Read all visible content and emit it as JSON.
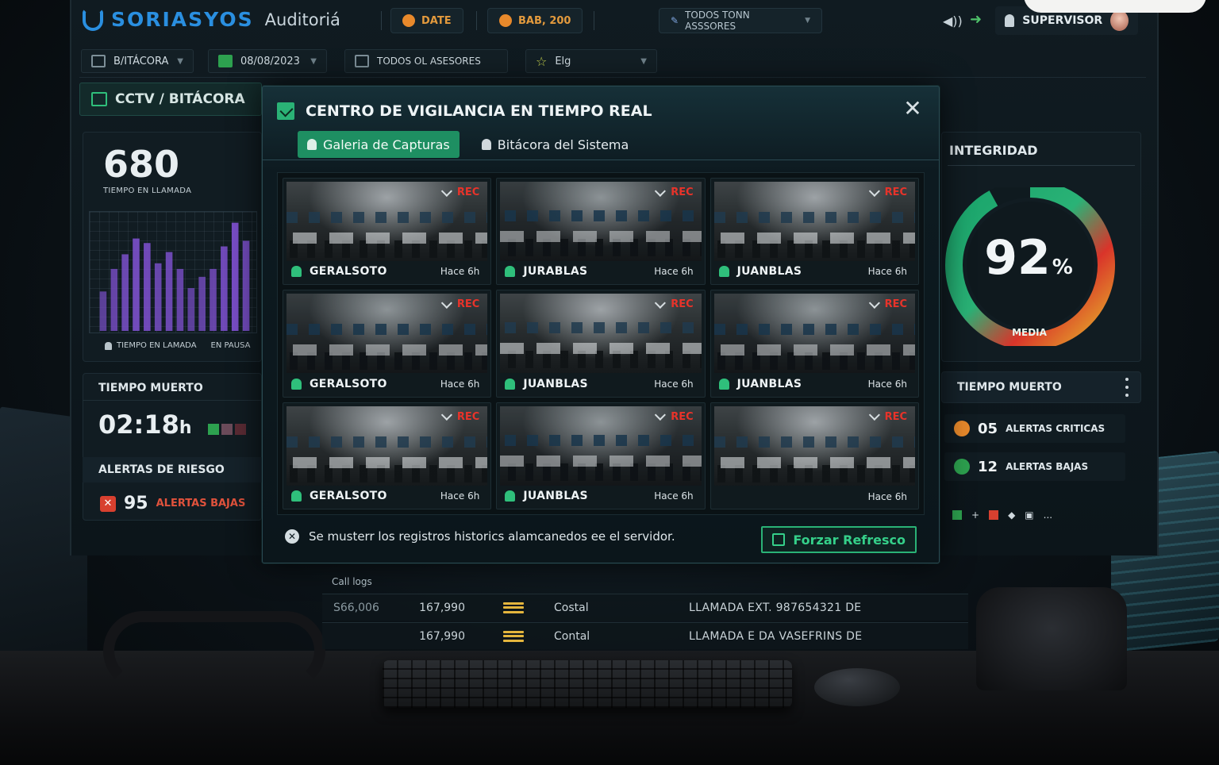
{
  "app": {
    "brand": "SORIASYOS",
    "module": "Auditoriá"
  },
  "topbar": {
    "date_label": "DATE",
    "status_label": "BAB, 200",
    "asesores_label": "TODOS TONN ASSSORES",
    "user_label": "SUPERVISOR"
  },
  "filters": {
    "bitacora": "B/ITÁCORA",
    "date": "08/08/2023",
    "asesores": "TODOS OL ASESORES",
    "star_filter": "Elg"
  },
  "left": {
    "section_tab": "CCTV / BITÁCORA",
    "metric_value": "680",
    "metric_label": "TIEMPO EN LLAMADA",
    "legend_a": "TIEMPO EN LAMADA",
    "legend_b": "EN PAUSA",
    "dead_time_title": "TIEMPO MUERTO",
    "dead_time_value": "02:18",
    "dead_time_unit": "h",
    "risk_title": "ALERTAS DE RIESGO",
    "risk_count": "95",
    "risk_label": "ALERTAS BAJAS"
  },
  "chart_data": {
    "type": "bar",
    "title": "",
    "xlabel": "",
    "ylabel": "",
    "values": [
      35,
      55,
      68,
      82,
      78,
      60,
      70,
      55,
      38,
      48,
      55,
      75,
      96,
      80
    ],
    "ylim": [
      0,
      100
    ],
    "grid": true,
    "legend": [
      "TIEMPO EN LAMADA",
      "EN PAUSA"
    ],
    "bar_color": "#7a4fc9"
  },
  "right": {
    "integrity_title": "INTEGRIDAD",
    "integrity_value": "92",
    "integrity_unit": "%",
    "integrity_level": "MEDIA",
    "integrity_fraction": 0.92,
    "dead_time_title": "TIEMPO MUERTO",
    "critical_count": "05",
    "critical_label": "ALERTAS CRITICAS",
    "low_count": "12",
    "low_label": "ALERTAS BAJAS",
    "more_label": "..."
  },
  "modal": {
    "title": "CENTRO DE VIGILANCIA EN TIEMPO REAL",
    "tabs": [
      {
        "label": "Galeria de Capturas",
        "active": true
      },
      {
        "label": "Bitácora del Sistema",
        "active": false
      }
    ],
    "rec_label": "REC",
    "captures": [
      {
        "name": "GERALSOTO",
        "time": "Hace 6h",
        "rec": true
      },
      {
        "name": "JURABLAS",
        "time": "Hace 6h",
        "rec": true
      },
      {
        "name": "JUANBLAS",
        "time": "Hace 6h",
        "rec": true
      },
      {
        "name": "GERALSOTO",
        "time": "Hace 6h",
        "rec": true
      },
      {
        "name": "JUANBLAS",
        "time": "Hace 6h",
        "rec": true
      },
      {
        "name": "JUANBLAS",
        "time": "Hace 6h",
        "rec": true
      },
      {
        "name": "GERALSOTO",
        "time": "Hace 6h",
        "rec": true
      },
      {
        "name": "JUANBLAS",
        "time": "Hace 6h",
        "rec": true
      },
      {
        "name": "",
        "time": "Hace 6h",
        "rec": true
      }
    ],
    "footer_note": "Se musterr los registros historics alamcanedos ee el servidor.",
    "refresh_button": "Forzar Refresco"
  },
  "call_logs": {
    "title": "Call logs",
    "rows": [
      {
        "id": "S66,006",
        "amount": "167,990",
        "type": "Costal",
        "detail": "LLAMADA EXT. 987654321 DE"
      },
      {
        "id": "",
        "amount": "167,990",
        "type": "Contal",
        "detail": "LLAMADA E DA VASEFRINS DE"
      }
    ]
  },
  "colors": {
    "accent_green": "#2ab276",
    "brand_blue": "#2a8fe0",
    "rec_red": "#e8332a",
    "warning_orange": "#e8892b"
  }
}
